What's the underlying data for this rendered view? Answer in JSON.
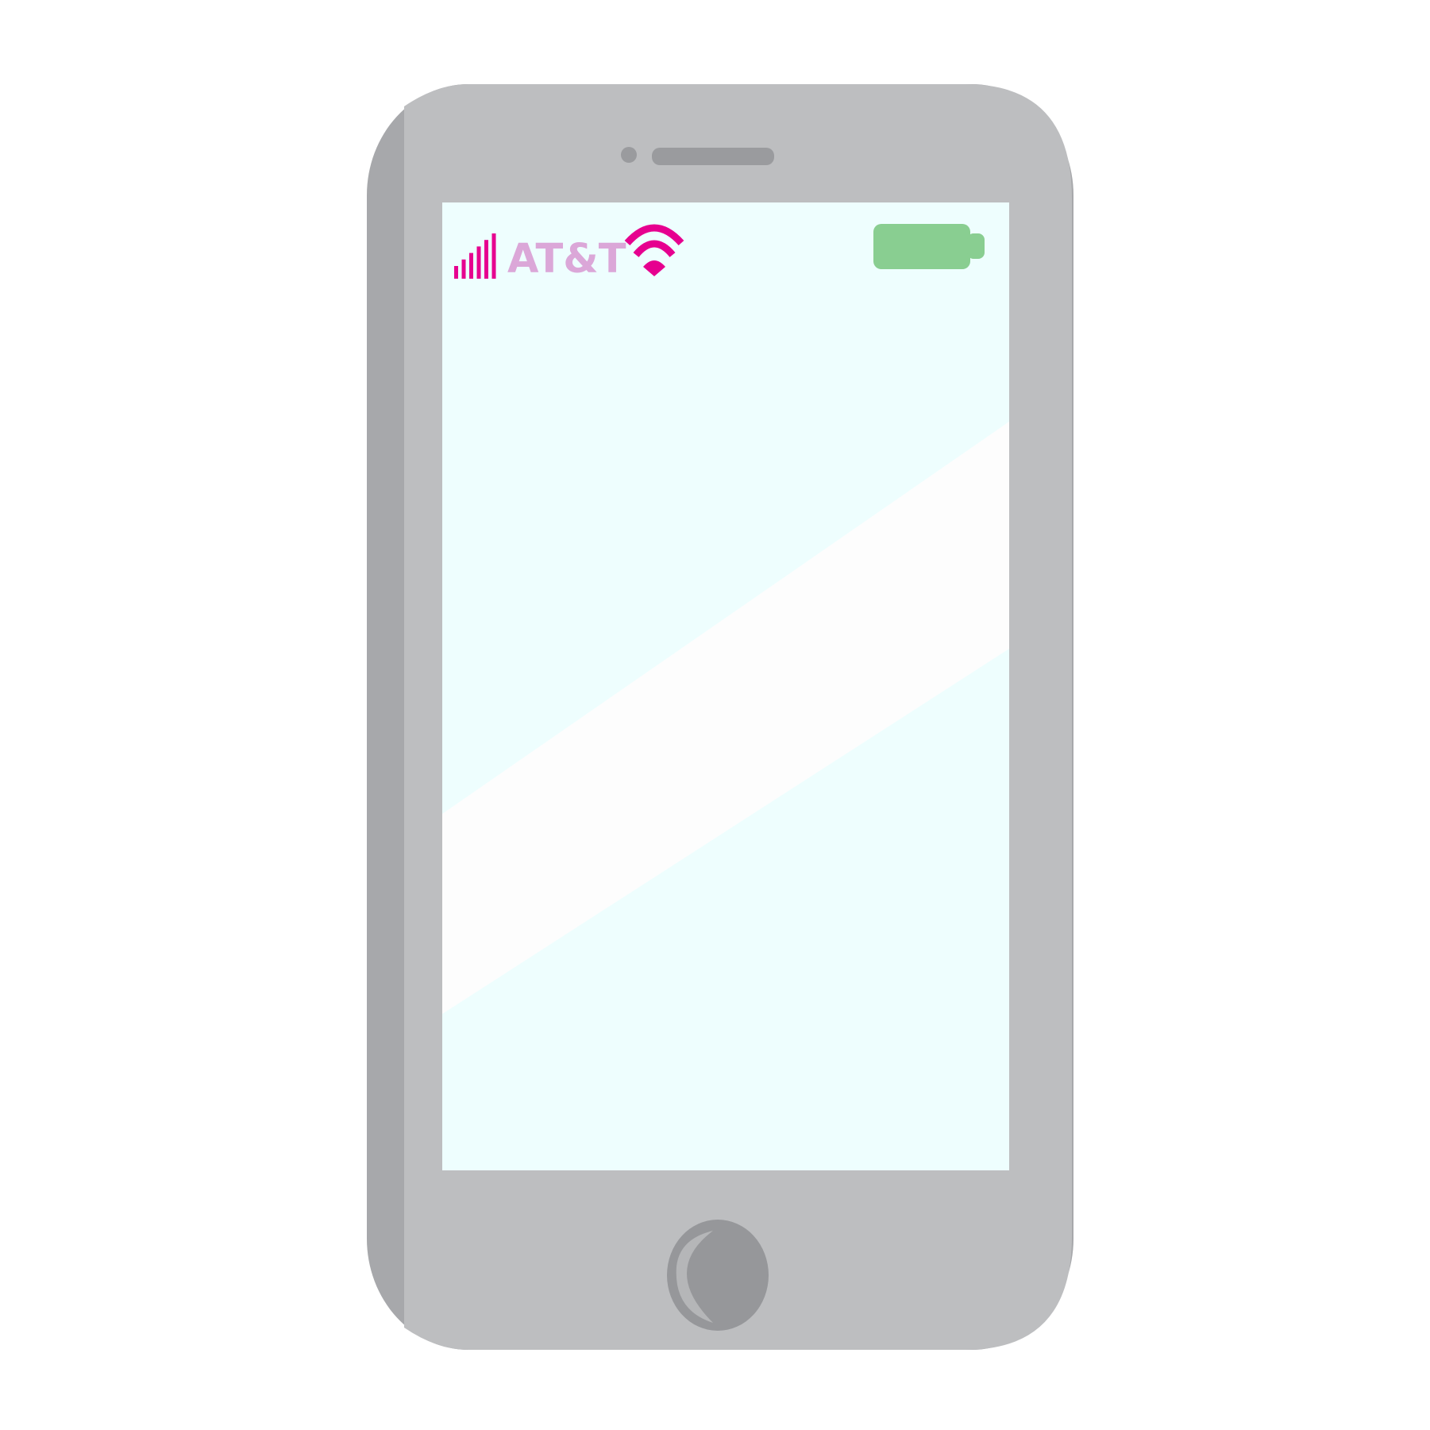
{
  "status_bar": {
    "carrier": "AT&T",
    "signal_bars": 6,
    "signal_icon": "signal-strength-icon",
    "wifi_icon": "wifi-icon",
    "battery_icon": "battery-icon",
    "battery_level": 1.0
  },
  "colors": {
    "phone_body": "#bdbec0",
    "phone_side_shade": "#a7a8ab",
    "speaker_and_camera": "#9a9b9e",
    "screen": "#eefefe",
    "screen_glare": "#fdfdfd",
    "accent_magenta": "#e6008f",
    "carrier_text": "#dba7d8",
    "battery_fill": "#89ce91",
    "home_button": "#96979a"
  }
}
